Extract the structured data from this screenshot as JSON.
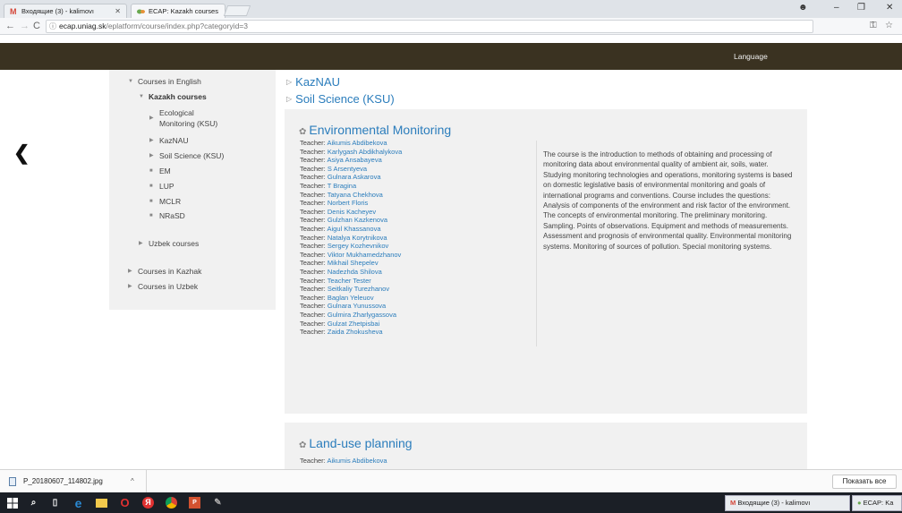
{
  "tabs": [
    {
      "label": "Входящие (3) - kalimovı",
      "active": false
    },
    {
      "label": "ECAP: Kazakh courses",
      "active": true
    }
  ],
  "addressbar": {
    "domain": "ecap.uniag.sk",
    "path": "/eplatform/course/index.php?categoryid=3"
  },
  "header": {
    "language_label": "Language"
  },
  "sidebar": {
    "items": [
      {
        "label": "Courses in English"
      },
      {
        "label": "Kazakh courses"
      },
      {
        "label": "Ecological"
      },
      {
        "label": "Monitoring (KSU)"
      },
      {
        "label": "KazNAU"
      },
      {
        "label": "Soil Science (KSU)"
      },
      {
        "label": "EM"
      },
      {
        "label": "LUP"
      },
      {
        "label": "MCLR"
      },
      {
        "label": "NRaSD"
      },
      {
        "label": "Uzbek courses"
      },
      {
        "label": "Courses in Kazhak"
      },
      {
        "label": "Courses in Uzbek"
      }
    ]
  },
  "main": {
    "subcategories": [
      "KazNAU",
      "Soil Science (KSU)"
    ],
    "course1": {
      "title": "Environmental Monitoring",
      "teacher_prefix": "Teacher:",
      "teachers": [
        "Aikumis Abdibekova",
        "Karlygash Abdikhalykova",
        "Asiya Ansabayeva",
        "S Arsentyeva",
        "Gulnara Askarova",
        "T Bragina",
        "Tatyana Chekhova",
        "Norbert Floris",
        "Denis Kacheyev",
        "Gulzhan Kazkenova",
        "Aigul Khassanova",
        "Natalya Korytnikova",
        "Sergey Kozhevnikov",
        "Viktor Mukhamedzhanov",
        "Mikhail Shepelev",
        "Nadezhda Shilova",
        "Teacher Tester",
        "Seitkaliy Turezhanov",
        "Baglan Yeleuov",
        "Gulnara Yunussova",
        "Gulmira Zharlygassova",
        "Gulzat Zhetpisbai",
        "Zaida Zhokusheva"
      ],
      "summary": "The course is the introduction to methods of obtaining and processing of monitoring data about environmental quality of ambient air, soils, water. Studying monitoring technologies and operations, monitoring systems is based on domestic legislative basis of environmental monitoring and goals of international programs and conventions. Course includes the questions: Analysis of components of the environment and risk factor of the environment. The concepts of environmental monitoring. The preliminary monitoring. Sampling. Points of observations. Equipment and methods of measurements. Assessment and prognosis of environmental quality. Environmental monitoring systems. Monitoring of sources of pollution. Special monitoring systems."
    },
    "course2": {
      "title": "Land-use planning",
      "teacher_prefix": "Teacher:",
      "first_teacher": "Aikumis Abdibekova"
    }
  },
  "downloads": {
    "filename": "P_20180607_114802.jpg",
    "show_all": "Показать все"
  },
  "taskbar": {
    "tab1": "Входящие (3) - kalimovı",
    "tab2": "ECAP: Ka"
  },
  "colors": {
    "header_bg": "#3a3221",
    "link": "#2b7dbc",
    "panel_bg": "#f1f1f1"
  }
}
